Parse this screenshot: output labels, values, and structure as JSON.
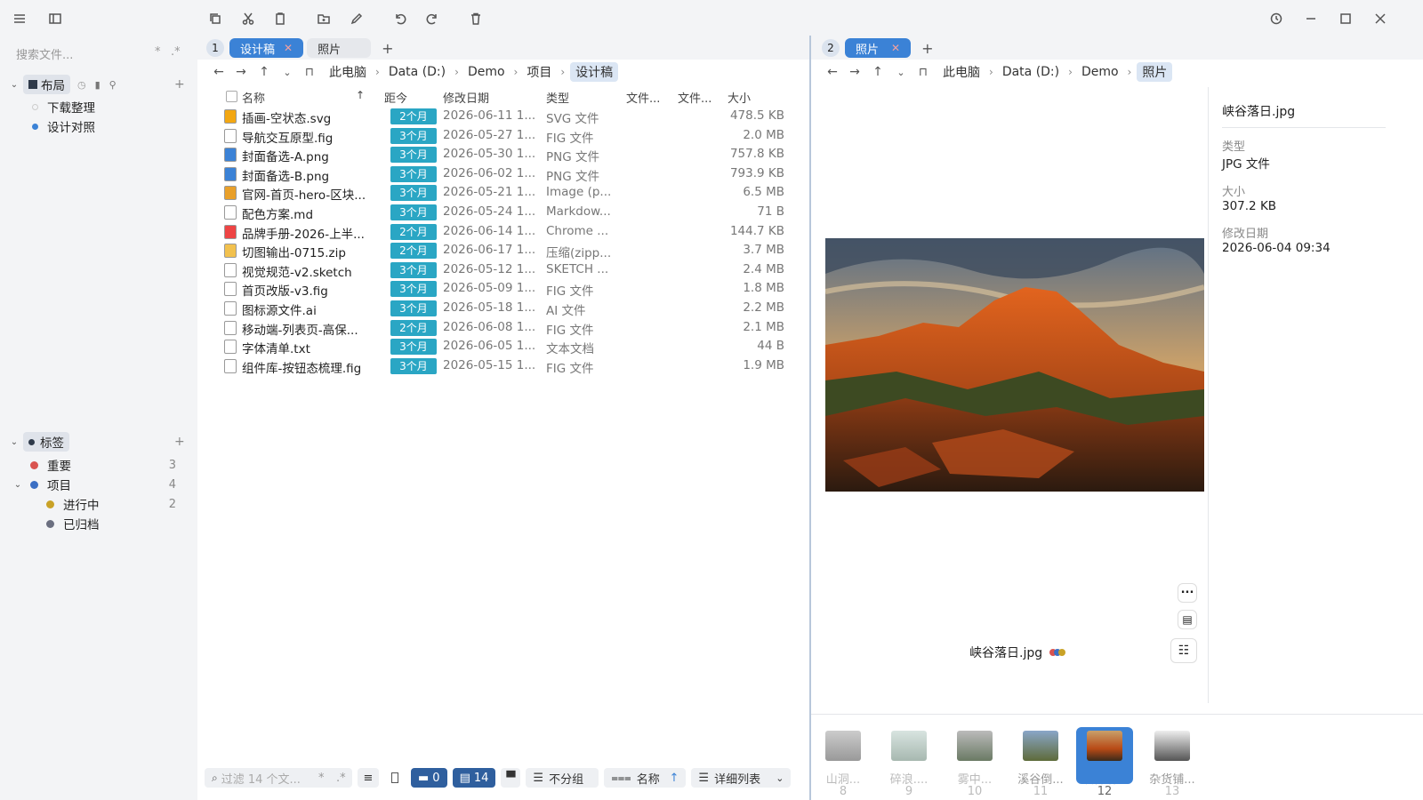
{
  "sidebar": {
    "search_placeholder": "搜索文件...",
    "search_opts": [
      "*",
      ".*"
    ],
    "layout_label": "布局",
    "layout_items": [
      "下载整理",
      "设计对照"
    ],
    "tags_label": "标签",
    "tags": [
      {
        "label": "重要",
        "count": "3",
        "color": "#d9534f"
      },
      {
        "label": "项目",
        "count": "4",
        "color": "#3b6fc4"
      },
      {
        "label": "进行中",
        "count": "2",
        "color": "#c9a227"
      },
      {
        "label": "已归档",
        "count": "",
        "color": "#6b6f80"
      }
    ]
  },
  "left": {
    "tab_number": "1",
    "tabs": [
      "设计稿",
      "照片"
    ],
    "breadcrumb": [
      "此电脑",
      "Data (D:)",
      "Demo",
      "项目",
      "设计稿"
    ],
    "columns": {
      "name": "名称",
      "age": "距今",
      "date": "修改日期",
      "type": "类型",
      "c1": "文件...",
      "c2": "文件...",
      "size": "大小"
    },
    "files": [
      {
        "name": "插画-空状态.svg",
        "age": "2个月",
        "date": "2026-06-11 1...",
        "type": "SVG 文件",
        "size": "478.5 KB"
      },
      {
        "name": "导航交互原型.fig",
        "age": "3个月",
        "date": "2026-05-27 1...",
        "type": "FIG 文件",
        "size": "2.0 MB"
      },
      {
        "name": "封面备选-A.png",
        "age": "3个月",
        "date": "2026-05-30 1...",
        "type": "PNG 文件",
        "size": "757.8 KB"
      },
      {
        "name": "封面备选-B.png",
        "age": "3个月",
        "date": "2026-06-02 1...",
        "type": "PNG 文件",
        "size": "793.9 KB"
      },
      {
        "name": "官网-首页-hero-区块...",
        "age": "3个月",
        "date": "2026-05-21 1...",
        "type": "Image (p...",
        "size": "6.5 MB"
      },
      {
        "name": "配色方案.md",
        "age": "3个月",
        "date": "2026-05-24 1...",
        "type": "Markdow...",
        "size": "71 B"
      },
      {
        "name": "品牌手册-2026-上半...",
        "age": "2个月",
        "date": "2026-06-14 1...",
        "type": "Chrome ...",
        "size": "144.7 KB"
      },
      {
        "name": "切图输出-0715.zip",
        "age": "2个月",
        "date": "2026-06-17 1...",
        "type": "压缩(zipp...",
        "size": "3.7 MB"
      },
      {
        "name": "视觉规范-v2.sketch",
        "age": "3个月",
        "date": "2026-05-12 1...",
        "type": "SKETCH ...",
        "size": "2.4 MB"
      },
      {
        "name": "首页改版-v3.fig",
        "age": "3个月",
        "date": "2026-05-09 1...",
        "type": "FIG 文件",
        "size": "1.8 MB"
      },
      {
        "name": "图标源文件.ai",
        "age": "3个月",
        "date": "2026-05-18 1...",
        "type": "AI 文件",
        "size": "2.2 MB"
      },
      {
        "name": "移动端-列表页-高保...",
        "age": "2个月",
        "date": "2026-06-08 1...",
        "type": "FIG 文件",
        "size": "2.1 MB"
      },
      {
        "name": "字体清单.txt",
        "age": "3个月",
        "date": "2026-06-05 1...",
        "type": "文本文档",
        "size": "44 B"
      },
      {
        "name": "组件库-按钮态梳理.fig",
        "age": "3个月",
        "date": "2026-05-15 1...",
        "type": "FIG 文件",
        "size": "1.9 MB"
      }
    ],
    "status": {
      "filter_placeholder": "过滤 14 个文...",
      "filter_opts": [
        "*",
        ".*"
      ],
      "folders": "0",
      "files": "14",
      "group": "不分组",
      "sort": "名称",
      "view": "详细列表"
    }
  },
  "right": {
    "tab_number": "2",
    "tabs": [
      "照片"
    ],
    "breadcrumb": [
      "此电脑",
      "Data (D:)",
      "Demo",
      "照片"
    ],
    "preview_name": "峡谷落日.jpg",
    "props": {
      "title": "峡谷落日.jpg",
      "type_label": "类型",
      "type_value": "JPG 文件",
      "size_label": "大小",
      "size_value": "307.2 KB",
      "date_label": "修改日期",
      "date_value": "2026-06-04 09:34"
    },
    "more": "...",
    "thumbs": [
      {
        "label": "山洞...",
        "num": "8"
      },
      {
        "label": "碎浪....",
        "num": "9"
      },
      {
        "label": "雾中...",
        "num": "10"
      },
      {
        "label": "溪谷倒...",
        "num": "11"
      },
      {
        "label": "峡谷落...",
        "num": "12"
      },
      {
        "label": "杂货铺...",
        "num": "13"
      }
    ]
  }
}
